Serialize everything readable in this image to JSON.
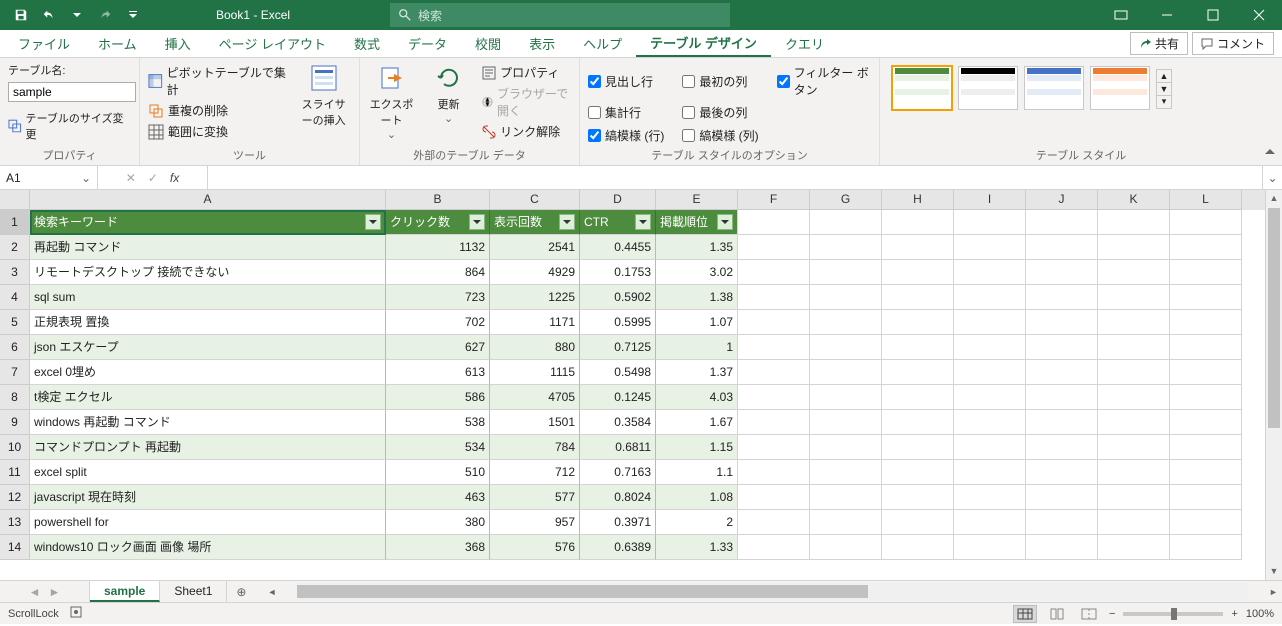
{
  "titlebar": {
    "title": "Book1  -  Excel",
    "search_placeholder": "検索"
  },
  "tabs": {
    "items": [
      "ファイル",
      "ホーム",
      "挿入",
      "ページ レイアウト",
      "数式",
      "データ",
      "校閲",
      "表示",
      "ヘルプ",
      "テーブル デザイン",
      "クエリ"
    ],
    "active": "テーブル デザイン",
    "share": "共有",
    "comments": "コメント"
  },
  "ribbon": {
    "properties": {
      "group": "プロパティ",
      "label": "テーブル名:",
      "value": "sample",
      "resize": "テーブルのサイズ変更"
    },
    "tools": {
      "group": "ツール",
      "pivot": "ピボットテーブルで集計",
      "dedupe": "重複の削除",
      "convert": "範囲に変換",
      "slicer": "スライサーの挿入"
    },
    "external": {
      "group": "外部のテーブル データ",
      "export": "エクスポート",
      "refresh": "更新",
      "props": "プロパティ",
      "browser": "ブラウザーで開く",
      "unlink": "リンク解除"
    },
    "styleopts": {
      "group": "テーブル スタイルのオプション",
      "header": "見出し行",
      "total": "集計行",
      "banded_rows": "縞模様 (行)",
      "first_col": "最初の列",
      "last_col": "最後の列",
      "banded_cols": "縞模様 (列)",
      "filter": "フィルター ボタン"
    },
    "styles": {
      "group": "テーブル スタイル"
    }
  },
  "formulabar": {
    "cellref": "A1",
    "formula": ""
  },
  "columns": [
    "A",
    "B",
    "C",
    "D",
    "E",
    "F",
    "G",
    "H",
    "I",
    "J",
    "K",
    "L"
  ],
  "table": {
    "headers": [
      "検索キーワード",
      "クリック数",
      "表示回数",
      "CTR",
      "掲載順位"
    ],
    "rows": [
      [
        "再起動 コマンド",
        1132,
        2541,
        0.4455,
        1.35
      ],
      [
        "リモートデスクトップ 接続できない",
        864,
        4929,
        0.1753,
        3.02
      ],
      [
        "sql sum",
        723,
        1225,
        0.5902,
        1.38
      ],
      [
        "正規表現 置換",
        702,
        1171,
        0.5995,
        1.07
      ],
      [
        "json エスケープ",
        627,
        880,
        0.7125,
        1
      ],
      [
        "excel 0埋め",
        613,
        1115,
        0.5498,
        1.37
      ],
      [
        "t検定 エクセル",
        586,
        4705,
        0.1245,
        4.03
      ],
      [
        "windows 再起動 コマンド",
        538,
        1501,
        0.3584,
        1.67
      ],
      [
        "コマンドプロンプト 再起動",
        534,
        784,
        0.6811,
        1.15
      ],
      [
        "excel split",
        510,
        712,
        0.7163,
        1.1
      ],
      [
        "javascript 現在時刻",
        463,
        577,
        0.8024,
        1.08
      ],
      [
        "powershell for",
        380,
        957,
        0.3971,
        2
      ],
      [
        "windows10 ロック画面 画像 場所",
        368,
        576,
        0.6389,
        1.33
      ]
    ]
  },
  "sheets": {
    "tabs": [
      "sample",
      "Sheet1"
    ],
    "active": "sample"
  },
  "statusbar": {
    "scrolllock": "ScrollLock",
    "zoom": "100%"
  }
}
